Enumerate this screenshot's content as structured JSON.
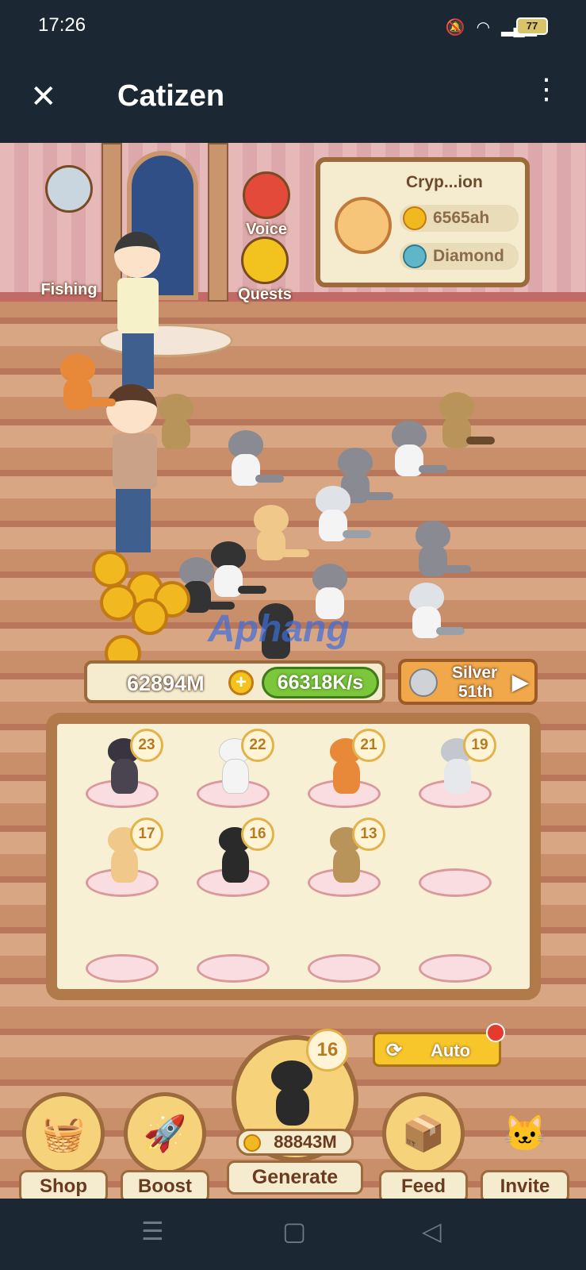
{
  "status_bar": {
    "time": "17:26",
    "battery": "77"
  },
  "titlebar": {
    "title": "Catizen"
  },
  "wall_buttons": {
    "fishing": "Fishing",
    "voice": "Voice",
    "quests": "Quests"
  },
  "info_panel": {
    "name": "Cryp...ion",
    "coins": "6565ah",
    "league": "Diamond"
  },
  "watermark": "Aphang",
  "coin_bar": {
    "total": "62894M",
    "rate": "66318K/s"
  },
  "rank": {
    "tier": "Silver",
    "position": "51th"
  },
  "cat_slots": [
    {
      "level": "23"
    },
    {
      "level": "22"
    },
    {
      "level": "21"
    },
    {
      "level": "19"
    },
    {
      "level": "17"
    },
    {
      "level": "16"
    },
    {
      "level": "13"
    },
    {
      "level": ""
    },
    {
      "level": ""
    },
    {
      "level": ""
    },
    {
      "level": ""
    },
    {
      "level": ""
    }
  ],
  "auto_button": "Auto",
  "generate": {
    "level": "16",
    "price": "88843M",
    "label": "Generate"
  },
  "nav": {
    "shop": "Shop",
    "boost": "Boost",
    "feed": "Feed",
    "invite": "Invite"
  },
  "colors": {
    "wood": "#9c6a3c",
    "board": "#f7f0d4",
    "rate_green": "#7bc63a",
    "coin": "#f2b81f"
  },
  "icons": [
    "wifi-icon",
    "signal-icon",
    "mute-icon",
    "close-icon",
    "more-vertical-icon",
    "menu-icon",
    "home-icon",
    "back-icon"
  ]
}
